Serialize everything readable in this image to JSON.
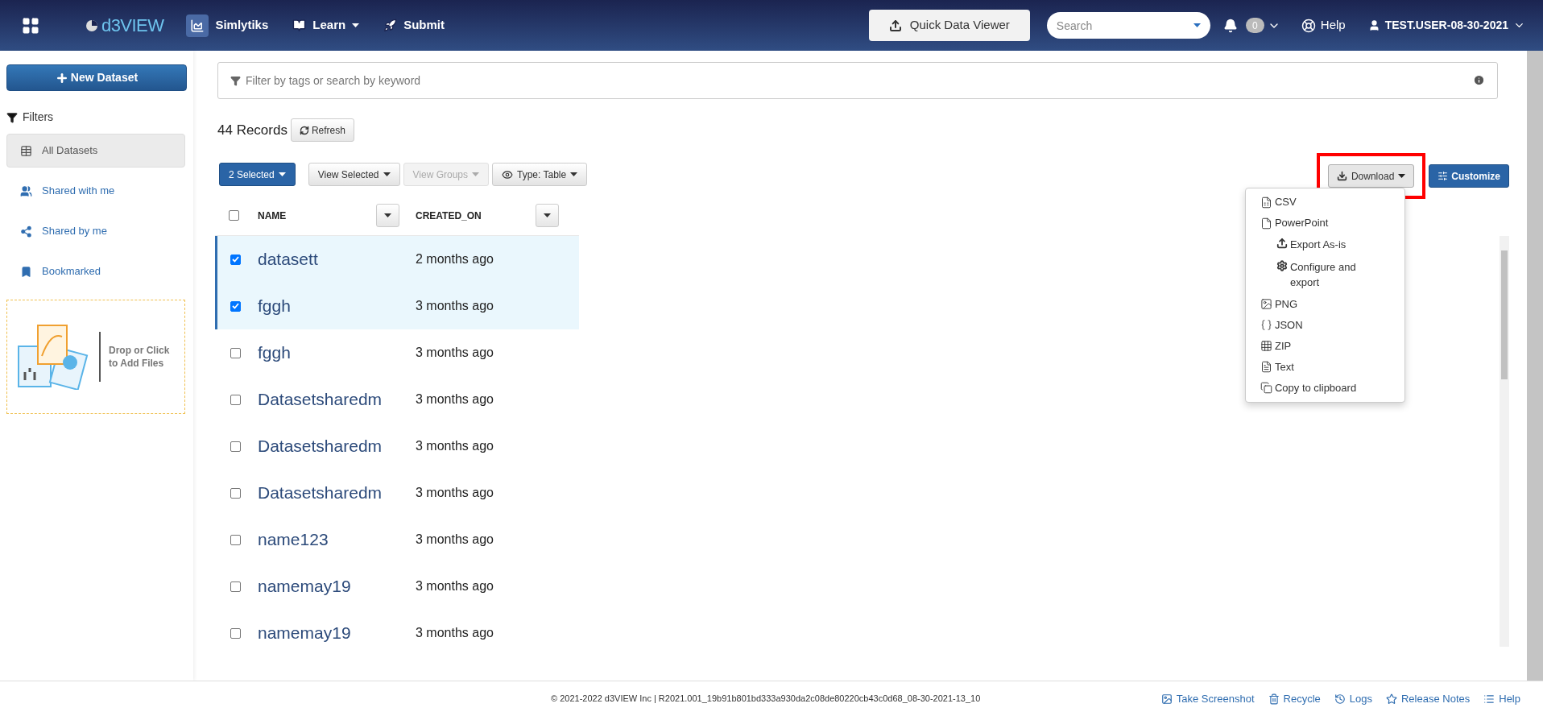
{
  "nav": {
    "brand": "d3VIEW",
    "items": [
      {
        "label": "Simlytiks",
        "kind": "app"
      },
      {
        "label": "Learn",
        "kind": "dropdown"
      },
      {
        "label": "Submit",
        "kind": "link"
      }
    ],
    "quick_viewer": "Quick Data Viewer",
    "search": {
      "placeholder": "Search"
    },
    "notifications": "0",
    "help": "Help",
    "user": "TEST.USER-08-30-2021"
  },
  "sidebar": {
    "new_button": "New Dataset",
    "filters_title": "Filters",
    "items": [
      {
        "label": "All Datasets",
        "selected": true
      },
      {
        "label": "Shared with me",
        "selected": false
      },
      {
        "label": "Shared by me",
        "selected": false
      },
      {
        "label": "Bookmarked",
        "selected": false
      }
    ],
    "dropzone": "Drop or Click to Add Files"
  },
  "filter": {
    "placeholder": "Filter by tags or search by keyword"
  },
  "records": "44 Records",
  "refresh": "Refresh",
  "toolbar": [
    {
      "label": "2 Selected",
      "kind": "primary",
      "disabled": false
    },
    {
      "label": "View Selected",
      "kind": "default",
      "disabled": false
    },
    {
      "label": "View Groups",
      "kind": "default",
      "disabled": true
    },
    {
      "label": "Type: Table",
      "kind": "eye",
      "disabled": false
    }
  ],
  "download": {
    "label": "Download",
    "highlighted": true,
    "menu": [
      {
        "label": "CSV"
      },
      {
        "label": "PowerPoint",
        "children": [
          {
            "label": "Export As-is"
          },
          {
            "label": "Configure and export"
          }
        ]
      },
      {
        "label": "PNG"
      },
      {
        "label": "JSON"
      },
      {
        "label": "ZIP"
      },
      {
        "label": "Text"
      },
      {
        "label": "Copy to clipboard"
      }
    ]
  },
  "customize": "Customize",
  "table": {
    "all_selected": false,
    "columns": [
      "NAME",
      "CREATED_ON"
    ],
    "rows": [
      {
        "name": "datasett",
        "created_on": "2 months ago",
        "selected": true
      },
      {
        "name": "fggh",
        "created_on": "3 months ago",
        "selected": true
      },
      {
        "name": "fggh",
        "created_on": "3 months ago",
        "selected": false
      },
      {
        "name": "Datasetsharedm",
        "created_on": "3 months ago",
        "selected": false
      },
      {
        "name": "Datasetsharedm",
        "created_on": "3 months ago",
        "selected": false
      },
      {
        "name": "Datasetsharedm",
        "created_on": "3 months ago",
        "selected": false
      },
      {
        "name": "name123",
        "created_on": "3 months ago",
        "selected": false
      },
      {
        "name": "namemay19",
        "created_on": "3 months ago",
        "selected": false
      },
      {
        "name": "namemay19",
        "created_on": "3 months ago",
        "selected": false
      }
    ]
  },
  "footer": {
    "copyright": "© 2021-2022 d3VIEW Inc | R2021.001_19b91b801bd333a930da2c08de80220cb43c0d68_08-30-2021-13_10",
    "links": [
      {
        "label": "Take Screenshot"
      },
      {
        "label": "Recycle"
      },
      {
        "label": "Logs"
      },
      {
        "label": "Release Notes"
      },
      {
        "label": "Help"
      }
    ]
  }
}
